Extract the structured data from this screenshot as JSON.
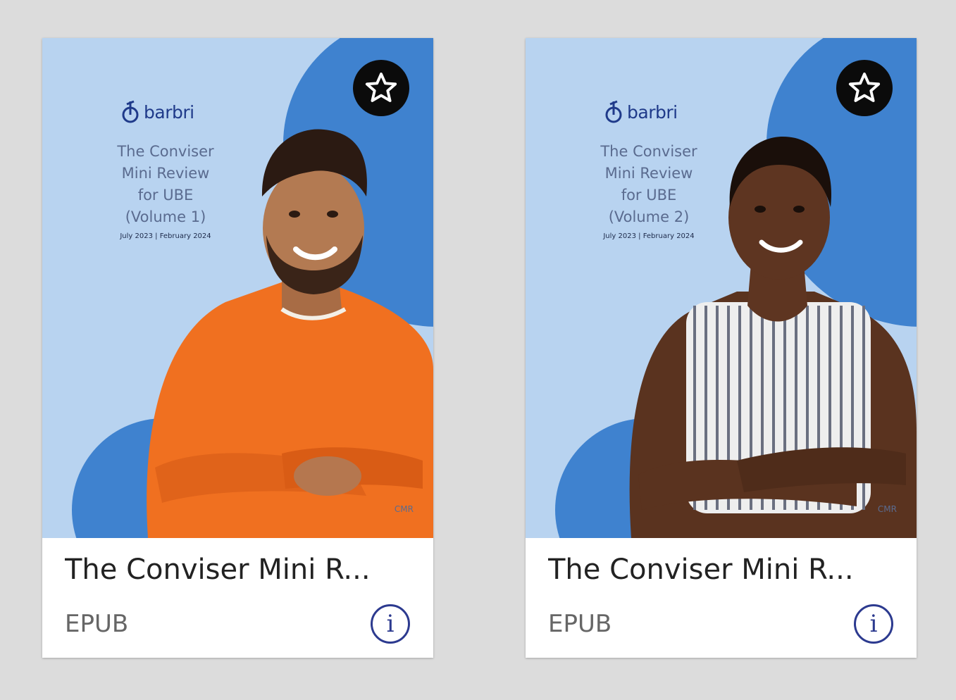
{
  "colors": {
    "page_bg": "#dcdcdc",
    "cover_light": "#b8d3f0",
    "cover_blob": "#3f82cf",
    "brand": "#1f3a8a",
    "favorite_bg": "#0b0b0b",
    "info_icon": "#2c3a8f",
    "card_bg": "#ffffff"
  },
  "icons": {
    "favorite": "star-outline-icon",
    "info": "info-circle-icon",
    "brand": "barbri-logo-icon"
  },
  "cards": [
    {
      "title": "The Conviser Mini R...",
      "format": "EPUB",
      "info_glyph": "i",
      "cover": {
        "brand": "barbri",
        "title_lines": [
          "The Conviser",
          "Mini Review",
          "for UBE",
          "(Volume 1)"
        ],
        "dates": "July 2023 | February 2024",
        "code": "CMR",
        "person": "man-orange-sweater"
      }
    },
    {
      "title": "The Conviser Mini R...",
      "format": "EPUB",
      "info_glyph": "i",
      "cover": {
        "brand": "barbri",
        "title_lines": [
          "The Conviser",
          "Mini Review",
          "for UBE",
          "(Volume 2)"
        ],
        "dates": "July 2023 | February 2024",
        "code": "CMR",
        "person": "woman-striped-top"
      }
    }
  ]
}
